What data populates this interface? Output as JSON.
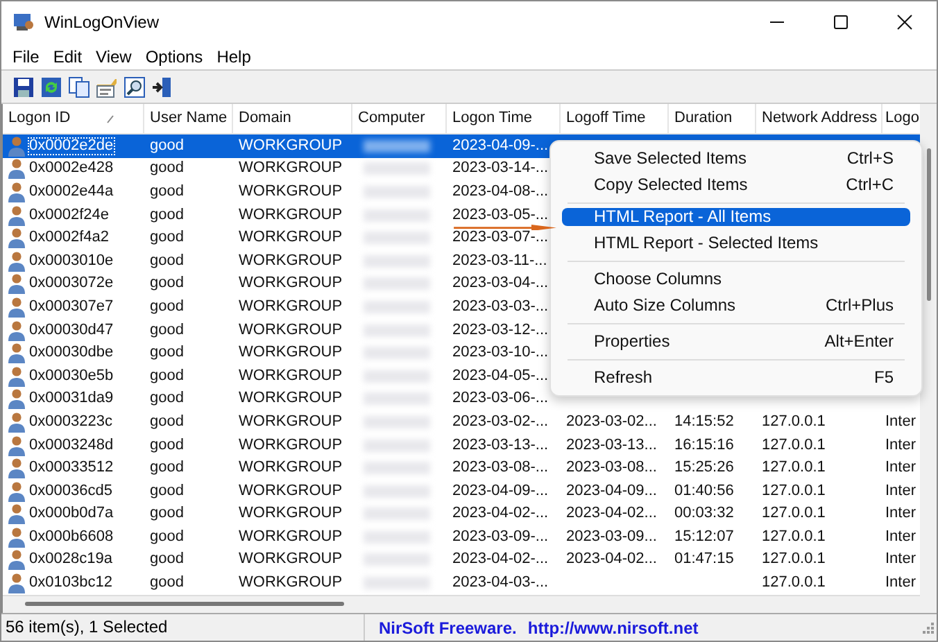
{
  "window": {
    "title": "WinLogOnView"
  },
  "menu_bar": [
    "File",
    "Edit",
    "View",
    "Options",
    "Help"
  ],
  "table": {
    "columns": [
      "Logon ID",
      "User Name",
      "Domain",
      "Computer",
      "Logon Time",
      "Logoff Time",
      "Duration",
      "Network Address",
      "Logo"
    ],
    "rows": [
      {
        "logon_id": "0x0002e2de",
        "user": "good",
        "domain": "WORKGROUP",
        "logon_time": "2023-04-09-...",
        "selected": true
      },
      {
        "logon_id": "0x0002e428",
        "user": "good",
        "domain": "WORKGROUP",
        "logon_time": "2023-03-14-...",
        "selected": false
      },
      {
        "logon_id": "0x0002e44a",
        "user": "good",
        "domain": "WORKGROUP",
        "logon_time": "2023-04-08-...",
        "selected": false
      },
      {
        "logon_id": "0x0002f24e",
        "user": "good",
        "domain": "WORKGROUP",
        "logon_time": "2023-03-05-...",
        "selected": false
      },
      {
        "logon_id": "0x0002f4a2",
        "user": "good",
        "domain": "WORKGROUP",
        "logon_time": "2023-03-07-...",
        "selected": false
      },
      {
        "logon_id": "0x0003010e",
        "user": "good",
        "domain": "WORKGROUP",
        "logon_time": "2023-03-11-...",
        "selected": false
      },
      {
        "logon_id": "0x0003072e",
        "user": "good",
        "domain": "WORKGROUP",
        "logon_time": "2023-03-04-...",
        "selected": false
      },
      {
        "logon_id": "0x000307e7",
        "user": "good",
        "domain": "WORKGROUP",
        "logon_time": "2023-03-03-...",
        "selected": false
      },
      {
        "logon_id": "0x00030d47",
        "user": "good",
        "domain": "WORKGROUP",
        "logon_time": "2023-03-12-...",
        "selected": false
      },
      {
        "logon_id": "0x00030dbe",
        "user": "good",
        "domain": "WORKGROUP",
        "logon_time": "2023-03-10-...",
        "selected": false
      },
      {
        "logon_id": "0x00030e5b",
        "user": "good",
        "domain": "WORKGROUP",
        "logon_time": "2023-04-05-...",
        "selected": false
      },
      {
        "logon_id": "0x00031da9",
        "user": "good",
        "domain": "WORKGROUP",
        "logon_time": "2023-03-06-...",
        "selected": false
      },
      {
        "logon_id": "0x0003223c",
        "user": "good",
        "domain": "WORKGROUP",
        "logon_time": "2023-03-02-...",
        "logoff_time": "2023-03-02...",
        "duration": "14:15:52",
        "network": "127.0.0.1",
        "logon_type": "Inter",
        "selected": false
      },
      {
        "logon_id": "0x0003248d",
        "user": "good",
        "domain": "WORKGROUP",
        "logon_time": "2023-03-13-...",
        "logoff_time": "2023-03-13...",
        "duration": "16:15:16",
        "network": "127.0.0.1",
        "logon_type": "Inter",
        "selected": false
      },
      {
        "logon_id": "0x00033512",
        "user": "good",
        "domain": "WORKGROUP",
        "logon_time": "2023-03-08-...",
        "logoff_time": "2023-03-08...",
        "duration": "15:25:26",
        "network": "127.0.0.1",
        "logon_type": "Inter",
        "selected": false
      },
      {
        "logon_id": "0x00036cd5",
        "user": "good",
        "domain": "WORKGROUP",
        "logon_time": "2023-04-09-...",
        "logoff_time": "2023-04-09...",
        "duration": "01:40:56",
        "network": "127.0.0.1",
        "logon_type": "Inter",
        "selected": false
      },
      {
        "logon_id": "0x000b0d7a",
        "user": "good",
        "domain": "WORKGROUP",
        "logon_time": "2023-04-02-...",
        "logoff_time": "2023-04-02...",
        "duration": "00:03:32",
        "network": "127.0.0.1",
        "logon_type": "Inter",
        "selected": false
      },
      {
        "logon_id": "0x000b6608",
        "user": "good",
        "domain": "WORKGROUP",
        "logon_time": "2023-03-09-...",
        "logoff_time": "2023-03-09...",
        "duration": "15:12:07",
        "network": "127.0.0.1",
        "logon_type": "Inter",
        "selected": false
      },
      {
        "logon_id": "0x0028c19a",
        "user": "good",
        "domain": "WORKGROUP",
        "logon_time": "2023-04-02-...",
        "logoff_time": "2023-04-02...",
        "duration": "01:47:15",
        "network": "127.0.0.1",
        "logon_type": "Inter",
        "selected": false
      },
      {
        "logon_id": "0x0103bc12",
        "user": "good",
        "domain": "WORKGROUP",
        "logon_time": "2023-04-03-...",
        "network": "127.0.0.1",
        "logon_type": "Inter",
        "selected": false
      }
    ]
  },
  "context_menu": {
    "items": [
      {
        "kind": "item",
        "label": "Save Selected Items",
        "shortcut": "Ctrl+S",
        "selected": false
      },
      {
        "kind": "item",
        "label": "Copy Selected Items",
        "shortcut": "Ctrl+C",
        "selected": false
      },
      {
        "kind": "separator"
      },
      {
        "kind": "item",
        "label": "HTML Report - All Items",
        "selected": true
      },
      {
        "kind": "item",
        "label": "HTML Report - Selected Items",
        "selected": false
      },
      {
        "kind": "separator"
      },
      {
        "kind": "item",
        "label": "Choose Columns",
        "selected": false
      },
      {
        "kind": "item",
        "label": "Auto Size Columns",
        "shortcut": "Ctrl+Plus",
        "selected": false
      },
      {
        "kind": "separator"
      },
      {
        "kind": "item",
        "label": "Properties",
        "shortcut": "Alt+Enter",
        "selected": false
      },
      {
        "kind": "separator"
      },
      {
        "kind": "item",
        "label": "Refresh",
        "shortcut": "F5",
        "selected": false
      }
    ]
  },
  "status_bar": {
    "count": "56 item(s), 1 Selected",
    "credit": "NirSoft Freeware.",
    "link": "http://www.nirsoft.net"
  }
}
